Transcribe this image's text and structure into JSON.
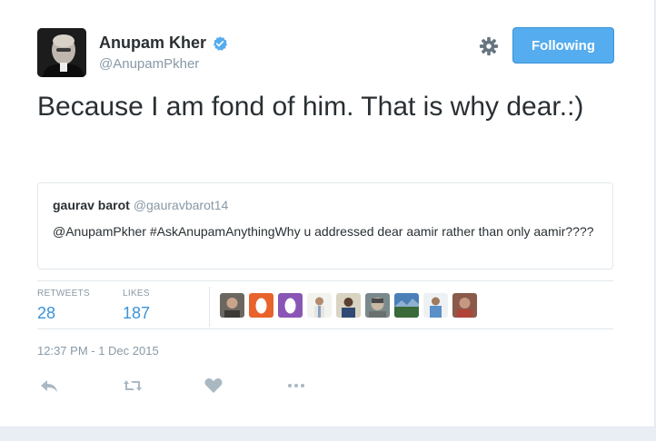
{
  "author": {
    "name": "Anupam Kher",
    "handle": "@AnupamPkher",
    "verified_icon": "verified-badge-icon"
  },
  "follow_button": {
    "label": "Following"
  },
  "tweet": {
    "text": "Because I am fond of him. That is why dear.:)"
  },
  "quoted_tweet": {
    "name": "gaurav barot",
    "handle": "@gauravbarot14",
    "text": "@AnupamPkher #AskAnupamAnythingWhy u addressed dear aamir rather than only aamir????"
  },
  "stats": {
    "retweets_label": "RETWEETS",
    "retweets_value": "28",
    "likes_label": "LIKES",
    "likes_value": "187"
  },
  "timestamp": "12:37 PM - 1 Dec 2015",
  "actions": [
    "reply-icon",
    "retweet-icon",
    "like-icon",
    "more-icon"
  ],
  "colors": {
    "accent": "#55acee",
    "link_blue": "#3b94d9",
    "muted": "#8899a6",
    "text": "#292f33",
    "border": "#e1e8ed"
  }
}
